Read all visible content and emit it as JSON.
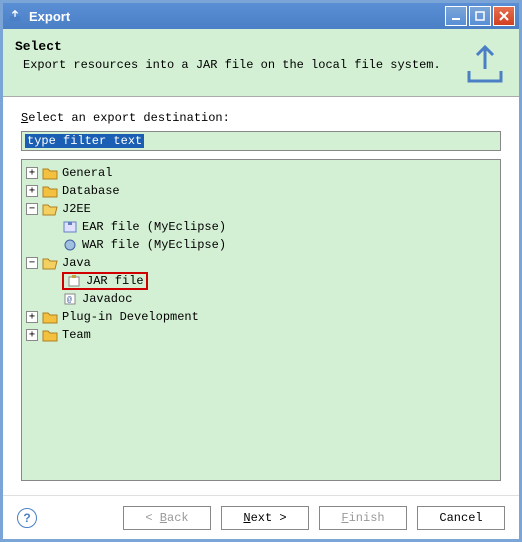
{
  "titlebar": {
    "title": "Export"
  },
  "header": {
    "title": "Select",
    "desc": "Export resources into a JAR file on the local file system."
  },
  "section_label_pre": "S",
  "section_label_rest": "elect an export destination:",
  "filter_placeholder": "type filter text",
  "tree": {
    "general": "General",
    "database": "Database",
    "j2ee": "J2EE",
    "ear": "EAR file (MyEclipse)",
    "war": "WAR file (MyEclipse)",
    "java": "Java",
    "jar": "JAR file",
    "javadoc": "Javadoc",
    "plugin": "Plug-in Development",
    "team": "Team"
  },
  "buttons": {
    "back_pre": "< ",
    "back_u": "B",
    "back_rest": "ack",
    "next_u": "N",
    "next_rest": "ext >",
    "finish_u": "F",
    "finish_rest": "inish",
    "cancel": "Cancel"
  }
}
